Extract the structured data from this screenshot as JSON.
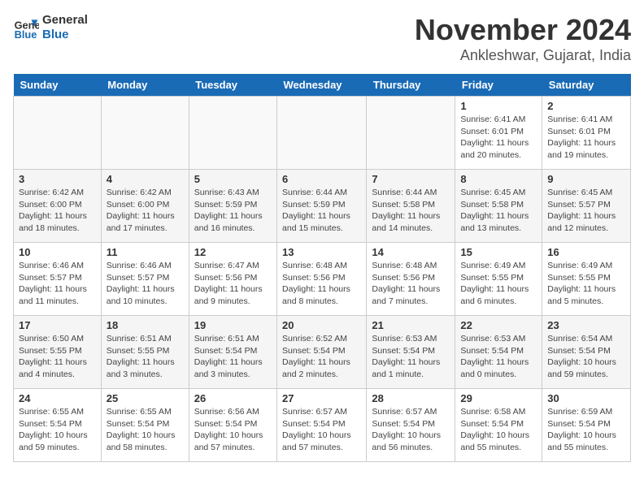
{
  "logo": {
    "line1": "General",
    "line2": "Blue"
  },
  "title": "November 2024",
  "location": "Ankleshwar, Gujarat, India",
  "days_of_week": [
    "Sunday",
    "Monday",
    "Tuesday",
    "Wednesday",
    "Thursday",
    "Friday",
    "Saturday"
  ],
  "weeks": [
    [
      {
        "day": "",
        "info": ""
      },
      {
        "day": "",
        "info": ""
      },
      {
        "day": "",
        "info": ""
      },
      {
        "day": "",
        "info": ""
      },
      {
        "day": "",
        "info": ""
      },
      {
        "day": "1",
        "info": "Sunrise: 6:41 AM\nSunset: 6:01 PM\nDaylight: 11 hours and 20 minutes."
      },
      {
        "day": "2",
        "info": "Sunrise: 6:41 AM\nSunset: 6:01 PM\nDaylight: 11 hours and 19 minutes."
      }
    ],
    [
      {
        "day": "3",
        "info": "Sunrise: 6:42 AM\nSunset: 6:00 PM\nDaylight: 11 hours and 18 minutes."
      },
      {
        "day": "4",
        "info": "Sunrise: 6:42 AM\nSunset: 6:00 PM\nDaylight: 11 hours and 17 minutes."
      },
      {
        "day": "5",
        "info": "Sunrise: 6:43 AM\nSunset: 5:59 PM\nDaylight: 11 hours and 16 minutes."
      },
      {
        "day": "6",
        "info": "Sunrise: 6:44 AM\nSunset: 5:59 PM\nDaylight: 11 hours and 15 minutes."
      },
      {
        "day": "7",
        "info": "Sunrise: 6:44 AM\nSunset: 5:58 PM\nDaylight: 11 hours and 14 minutes."
      },
      {
        "day": "8",
        "info": "Sunrise: 6:45 AM\nSunset: 5:58 PM\nDaylight: 11 hours and 13 minutes."
      },
      {
        "day": "9",
        "info": "Sunrise: 6:45 AM\nSunset: 5:57 PM\nDaylight: 11 hours and 12 minutes."
      }
    ],
    [
      {
        "day": "10",
        "info": "Sunrise: 6:46 AM\nSunset: 5:57 PM\nDaylight: 11 hours and 11 minutes."
      },
      {
        "day": "11",
        "info": "Sunrise: 6:46 AM\nSunset: 5:57 PM\nDaylight: 11 hours and 10 minutes."
      },
      {
        "day": "12",
        "info": "Sunrise: 6:47 AM\nSunset: 5:56 PM\nDaylight: 11 hours and 9 minutes."
      },
      {
        "day": "13",
        "info": "Sunrise: 6:48 AM\nSunset: 5:56 PM\nDaylight: 11 hours and 8 minutes."
      },
      {
        "day": "14",
        "info": "Sunrise: 6:48 AM\nSunset: 5:56 PM\nDaylight: 11 hours and 7 minutes."
      },
      {
        "day": "15",
        "info": "Sunrise: 6:49 AM\nSunset: 5:55 PM\nDaylight: 11 hours and 6 minutes."
      },
      {
        "day": "16",
        "info": "Sunrise: 6:49 AM\nSunset: 5:55 PM\nDaylight: 11 hours and 5 minutes."
      }
    ],
    [
      {
        "day": "17",
        "info": "Sunrise: 6:50 AM\nSunset: 5:55 PM\nDaylight: 11 hours and 4 minutes."
      },
      {
        "day": "18",
        "info": "Sunrise: 6:51 AM\nSunset: 5:55 PM\nDaylight: 11 hours and 3 minutes."
      },
      {
        "day": "19",
        "info": "Sunrise: 6:51 AM\nSunset: 5:54 PM\nDaylight: 11 hours and 3 minutes."
      },
      {
        "day": "20",
        "info": "Sunrise: 6:52 AM\nSunset: 5:54 PM\nDaylight: 11 hours and 2 minutes."
      },
      {
        "day": "21",
        "info": "Sunrise: 6:53 AM\nSunset: 5:54 PM\nDaylight: 11 hours and 1 minute."
      },
      {
        "day": "22",
        "info": "Sunrise: 6:53 AM\nSunset: 5:54 PM\nDaylight: 11 hours and 0 minutes."
      },
      {
        "day": "23",
        "info": "Sunrise: 6:54 AM\nSunset: 5:54 PM\nDaylight: 10 hours and 59 minutes."
      }
    ],
    [
      {
        "day": "24",
        "info": "Sunrise: 6:55 AM\nSunset: 5:54 PM\nDaylight: 10 hours and 59 minutes."
      },
      {
        "day": "25",
        "info": "Sunrise: 6:55 AM\nSunset: 5:54 PM\nDaylight: 10 hours and 58 minutes."
      },
      {
        "day": "26",
        "info": "Sunrise: 6:56 AM\nSunset: 5:54 PM\nDaylight: 10 hours and 57 minutes."
      },
      {
        "day": "27",
        "info": "Sunrise: 6:57 AM\nSunset: 5:54 PM\nDaylight: 10 hours and 57 minutes."
      },
      {
        "day": "28",
        "info": "Sunrise: 6:57 AM\nSunset: 5:54 PM\nDaylight: 10 hours and 56 minutes."
      },
      {
        "day": "29",
        "info": "Sunrise: 6:58 AM\nSunset: 5:54 PM\nDaylight: 10 hours and 55 minutes."
      },
      {
        "day": "30",
        "info": "Sunrise: 6:59 AM\nSunset: 5:54 PM\nDaylight: 10 hours and 55 minutes."
      }
    ]
  ]
}
